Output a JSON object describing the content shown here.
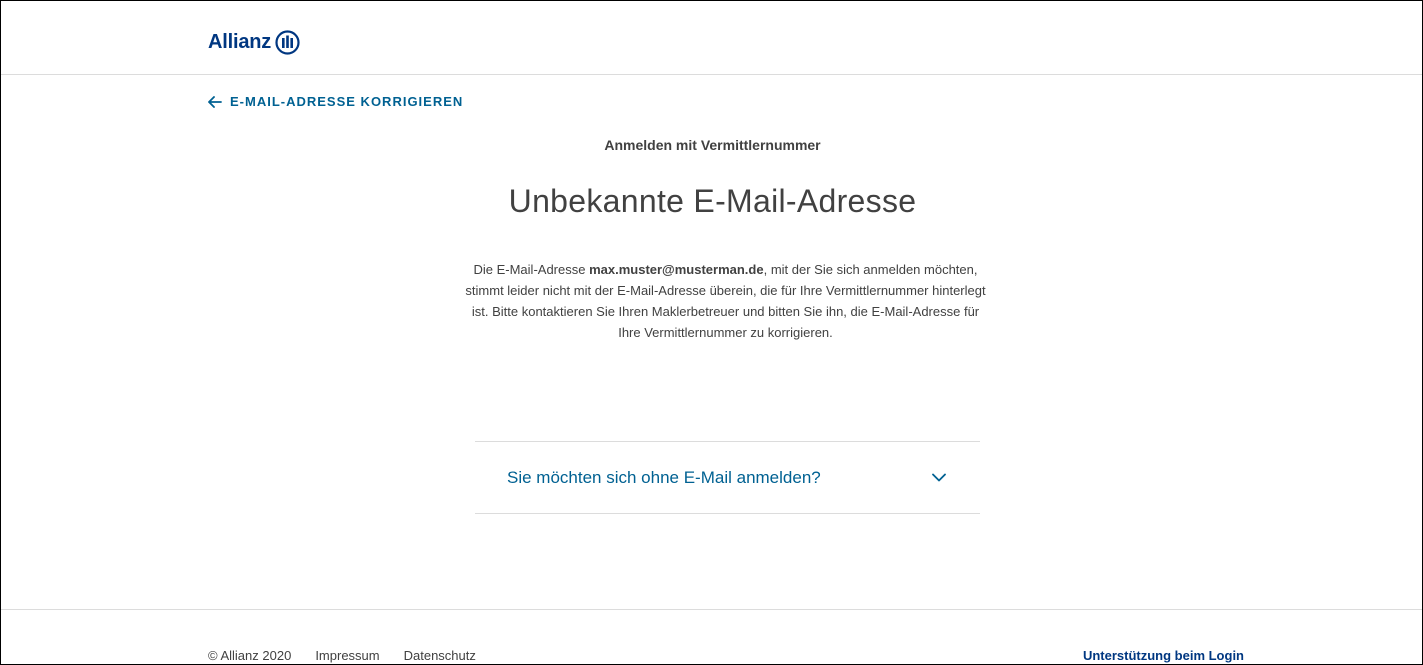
{
  "header": {
    "logo_text": "Allianz"
  },
  "back_link": {
    "label": "E-MAIL-ADRESSE KORRIGIEREN"
  },
  "main": {
    "eyebrow": "Anmelden mit Vermittlernummer",
    "title": "Unbekannte E-Mail-Adresse",
    "description": {
      "prefix": "Die E-Mail-Adresse ",
      "email": "max.muster@musterman.de",
      "suffix": ", mit der Sie sich anmelden möchten, stimmt leider nicht mit der E-Mail-Adresse überein, die für Ihre Vermittlernummer hinterlegt ist. Bitte kontaktieren Sie Ihren Maklerbetreuer und bitten Sie ihn, die E-Mail-Adresse für Ihre Vermittlernummer zu korrigieren."
    },
    "accordion": {
      "label": "Sie möchten sich ohne E-Mail anmelden?",
      "icon": "chevron-down-icon"
    }
  },
  "footer": {
    "copyright": "© Allianz 2020",
    "impressum": "Impressum",
    "datenschutz": "Datenschutz",
    "support": "Unterstützung beim Login"
  },
  "colors": {
    "brand_blue": "#003781",
    "link_blue": "#006192",
    "text": "#414141",
    "divider": "#dcdcdc"
  }
}
